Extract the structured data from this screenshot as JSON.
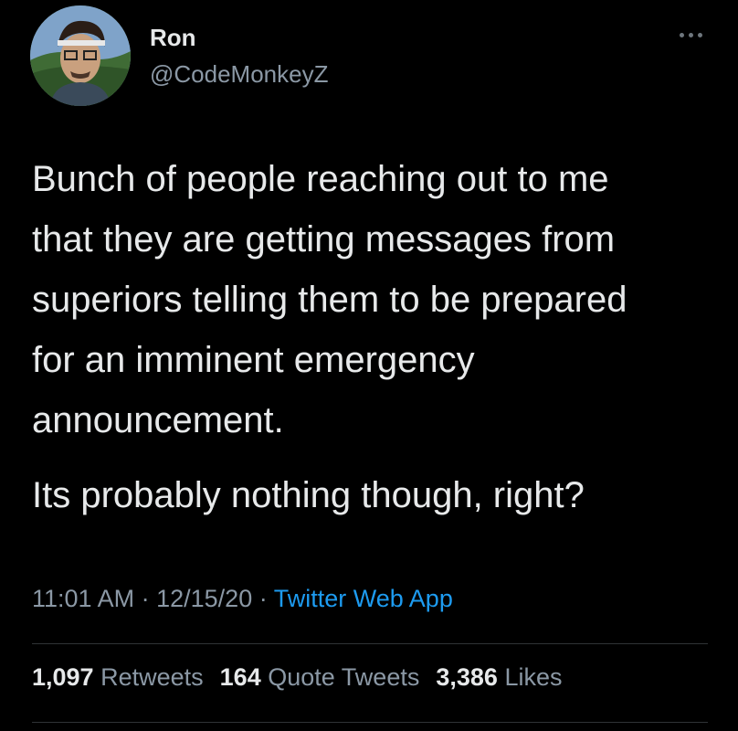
{
  "author": {
    "display_name": "Ron",
    "handle": "@CodeMonkeyZ"
  },
  "tweet": {
    "text_paragraph_1": "Bunch of people reaching out to me\nthat they are getting messages from\nsuperiors telling them to be prepared\nfor an imminent emergency\nannouncement.",
    "text_paragraph_2": "Its probably nothing though, right?",
    "time": "11:01 AM",
    "date": "12/15/20",
    "separator": "·",
    "source": "Twitter Web App"
  },
  "stats": {
    "retweets_count": "1,097",
    "retweets_label": "Retweets",
    "quotes_count": "164",
    "quotes_label": "Quote Tweets",
    "likes_count": "3,386",
    "likes_label": "Likes"
  },
  "icons": {
    "more": "more-options-icon",
    "avatar": "profile-photo"
  },
  "colors": {
    "background": "#000000",
    "primary_text": "#e7e9ea",
    "secondary_text": "#8b98a5",
    "link": "#1d9bf0",
    "divider": "#2f3336"
  }
}
